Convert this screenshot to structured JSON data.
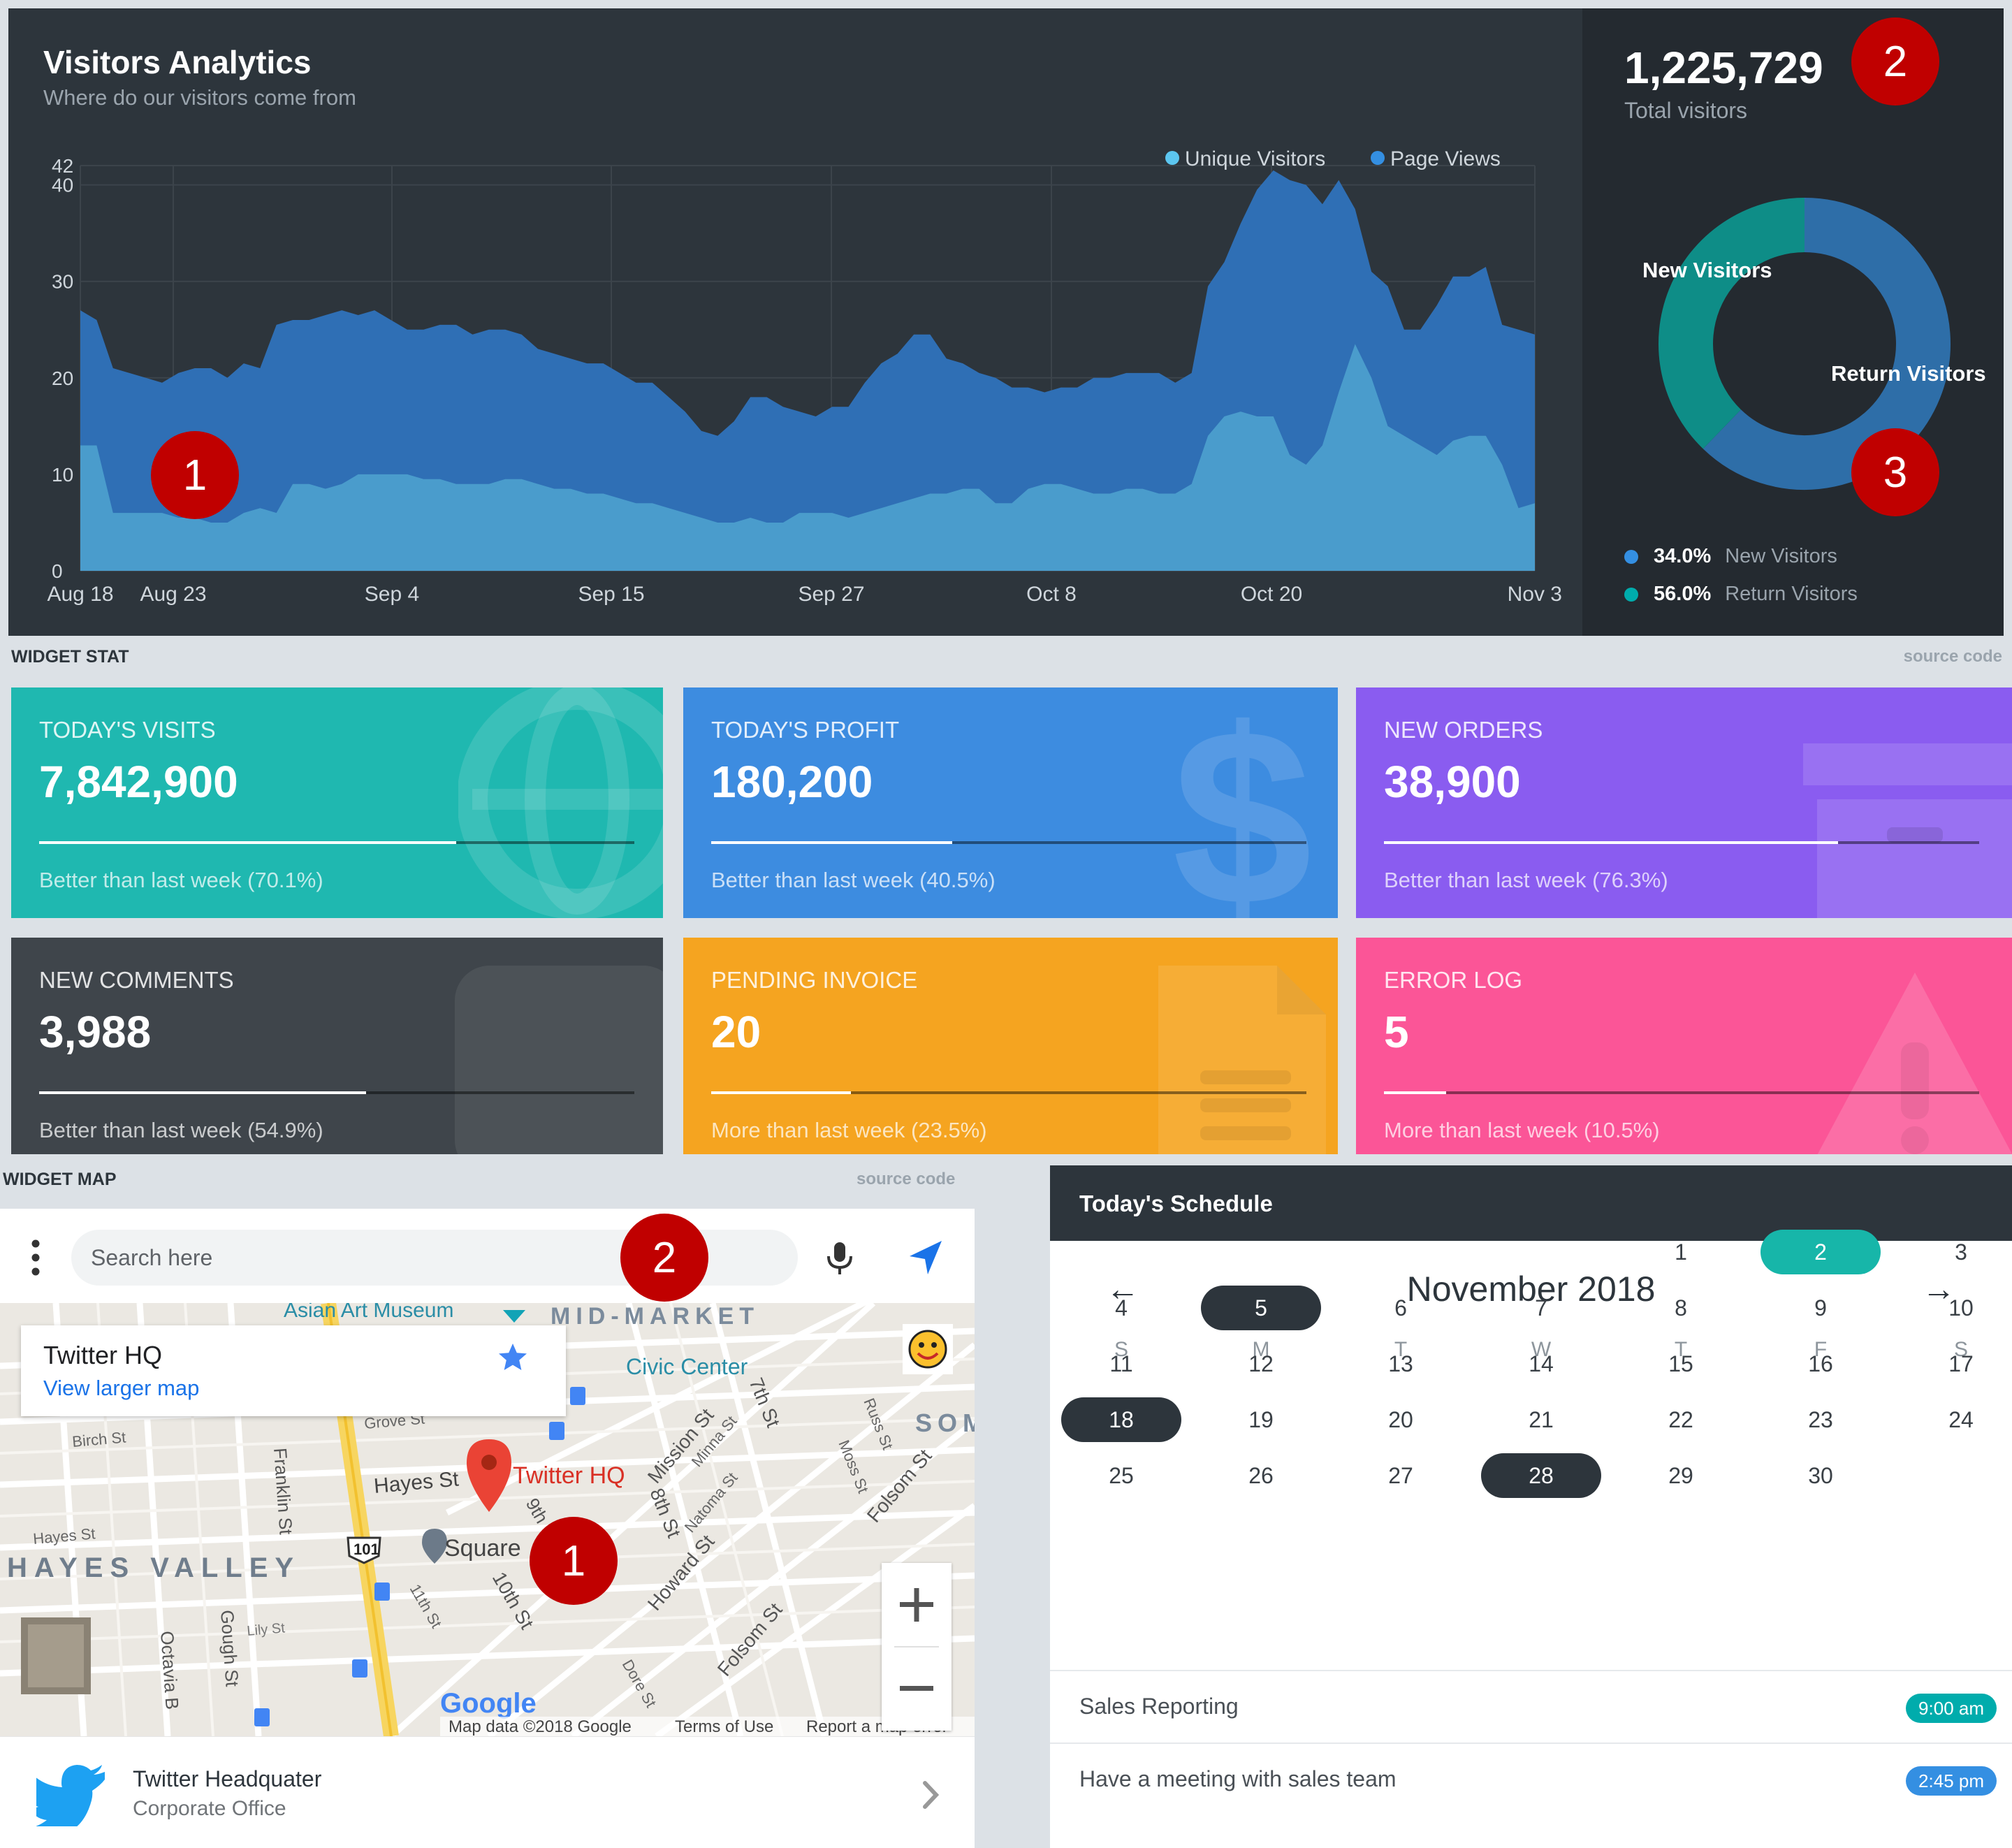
{
  "analytics": {
    "title": "Visitors Analytics",
    "subtitle": "Where do our visitors come from",
    "legend": [
      "Unique Visitors",
      "Page Views"
    ],
    "total_value": "1,225,729",
    "total_label": "Total visitors",
    "donut_labels": {
      "new": "New Visitors",
      "return": "Return Visitors"
    },
    "percentages": [
      {
        "value": "34.0%",
        "label": "New Visitors",
        "color": "#348fe2"
      },
      {
        "value": "56.0%",
        "label": "Return Visitors",
        "color": "#00acac"
      }
    ]
  },
  "badges": {
    "chart": "1",
    "total": "2",
    "donut": "3",
    "map_search": "2",
    "map_pin": "1"
  },
  "chart_data": [
    {
      "type": "area",
      "title": "Visitors Analytics",
      "x_ticks": [
        "Aug 18",
        "Aug 23",
        "Sep 4",
        "Sep 15",
        "Sep 27",
        "Oct 8",
        "Oct 20",
        "Nov 3"
      ],
      "y_ticks": [
        0,
        10,
        20,
        30,
        40,
        42
      ],
      "ylim": [
        0,
        42
      ],
      "colors": {
        "page_views": "#2f6fb5",
        "unique_visitors": "#4a9ccc"
      },
      "series": [
        {
          "name": "Page Views",
          "values": [
            27,
            26,
            21,
            20.5,
            20,
            19.5,
            20.5,
            21,
            21,
            20,
            21.5,
            21,
            25.5,
            26,
            26,
            26.5,
            27,
            26.5,
            27,
            26,
            25,
            25,
            25.5,
            25.5,
            24.5,
            25,
            25,
            24.5,
            23,
            22.5,
            22,
            21.5,
            21.5,
            20.5,
            19.5,
            19.5,
            18,
            16.5,
            14.5,
            14,
            15.5,
            18,
            18,
            17,
            16.5,
            16,
            17,
            17,
            19.5,
            21.5,
            22.5,
            24.5,
            24.5,
            22,
            21.5,
            20.5,
            20,
            19,
            19,
            18.5,
            19,
            19,
            20,
            20,
            20.5,
            20.5,
            20.5,
            19.5,
            20.5,
            29.5,
            32,
            36,
            39.5,
            41.5,
            40.5,
            40,
            38,
            40.5,
            37.5,
            31,
            29.5,
            25,
            25,
            27.5,
            30.5,
            30.5,
            31.5,
            25.5,
            25,
            24.5
          ]
        },
        {
          "name": "Unique Visitors",
          "values": [
            13,
            13,
            6,
            6,
            6,
            6,
            5.5,
            5.5,
            5,
            5,
            6,
            6.5,
            6,
            9,
            9,
            8.5,
            9,
            10,
            10,
            10,
            10,
            9.5,
            9.5,
            9,
            9,
            9,
            9.5,
            9.5,
            9,
            8.5,
            8.5,
            8,
            8,
            7.5,
            7,
            7,
            6.5,
            6,
            5.5,
            5,
            5,
            5.5,
            5,
            5,
            6,
            6,
            6,
            5.5,
            6,
            6.5,
            7,
            7.5,
            8,
            8,
            8.5,
            8.5,
            7,
            7,
            8.5,
            9,
            9,
            8.5,
            8,
            8,
            8.5,
            8.5,
            8,
            8,
            9,
            14,
            16,
            16.5,
            16,
            16,
            12,
            11,
            13,
            18.5,
            23.5,
            20,
            15,
            14,
            13,
            12,
            13.5,
            14,
            14,
            11,
            6.5,
            7
          ]
        }
      ]
    },
    {
      "type": "pie",
      "categories": [
        "New Visitors",
        "Return Visitors"
      ],
      "values": [
        34.0,
        56.0
      ],
      "colors": [
        "#00acac",
        "#348fe2"
      ]
    }
  ],
  "widget_stat": {
    "section_label": "WIDGET STAT",
    "source_link": "source code",
    "cards": [
      {
        "title": "TODAY'S VISITS",
        "value": "7,842,900",
        "desc": "Better than last week (70.1%)",
        "progress": 0.701,
        "icon": "globe-icon",
        "bg": "#1fb8b0"
      },
      {
        "title": "TODAY'S PROFIT",
        "value": "180,200",
        "desc": "Better than last week (40.5%)",
        "progress": 0.405,
        "icon": "dollar-icon",
        "bg": "#3d8ce0"
      },
      {
        "title": "NEW ORDERS",
        "value": "38,900",
        "desc": "Better than last week (76.3%)",
        "progress": 0.763,
        "icon": "archive-icon",
        "bg": "#8a5cf0"
      },
      {
        "title": "NEW COMMENTS",
        "value": "3,988",
        "desc": "Better than last week (54.9%)",
        "progress": 0.549,
        "icon": "comment-icon",
        "bg": "#3f454b"
      },
      {
        "title": "PENDING INVOICE",
        "value": "20",
        "desc": "More than last week (23.5%)",
        "progress": 0.235,
        "icon": "file-icon",
        "bg": "#f5a420"
      },
      {
        "title": "ERROR LOG",
        "value": "5",
        "desc": "More than last week (10.5%)",
        "progress": 0.105,
        "icon": "warning-icon",
        "bg": "#fb5597"
      }
    ]
  },
  "widget_map": {
    "section_label": "WIDGET MAP",
    "source_link": "source code",
    "search_placeholder": "Search here",
    "info_title": "Twitter HQ",
    "info_link": "View larger map",
    "pin_label": "Twitter HQ",
    "map_labels": {
      "museum": "Asian Art Museum",
      "mid_market": "MID-MARKET",
      "civic_center": "Civic Center",
      "soma": "SOM",
      "hayes_valley": "HAYES VALLEY",
      "hayes_st": "Hayes St",
      "hayes_st_small": "Hayes St",
      "grove_st": "Grove St",
      "birch_st": "Birch St",
      "franklin_st": "Franklin St",
      "gough_st": "Gough St",
      "octavia": "Octavia B",
      "lily_st": "Lily St",
      "mission_st": "Mission St",
      "minna_st": "Minna St",
      "seventh_st": "7th St",
      "eighth_st": "8th St",
      "natoma_st": "Natoma St",
      "russ_st": "Russ St",
      "moss_st": "Moss St",
      "folsom_st": "Folsom St",
      "folsom_st_lower": "Folsom St",
      "howard_st": "Howard St",
      "tenth_st": "10th St",
      "eleventh_st": "11th St",
      "ninth": "9th",
      "dore_st": "Dore St",
      "square": "Square",
      "route": "101",
      "google": "Google",
      "map_data": "Map data ©2018 Google",
      "terms": "Terms of Use",
      "report": "Report a map error"
    },
    "place_title": "Twitter Headquater",
    "place_subtitle": "Corporate Office"
  },
  "schedule": {
    "title": "Today's Schedule",
    "month": "November 2018",
    "weekdays": [
      "S",
      "M",
      "T",
      "W",
      "T",
      "F",
      "S"
    ],
    "weeks": [
      [
        "",
        "",
        "",
        "",
        "1",
        "2",
        "3"
      ],
      [
        "4",
        "5",
        "6",
        "7",
        "8",
        "9",
        "10"
      ],
      [
        "11",
        "12",
        "13",
        "14",
        "15",
        "16",
        "17"
      ],
      [
        "18",
        "19",
        "20",
        "21",
        "22",
        "23",
        "24"
      ],
      [
        "25",
        "26",
        "27",
        "28",
        "29",
        "30",
        ""
      ]
    ],
    "highlight_teal": [
      "2"
    ],
    "highlight_dark": [
      "5",
      "18",
      "28"
    ],
    "events": [
      {
        "name": "Sales Reporting",
        "time": "9:00 am",
        "color": "#00acac"
      },
      {
        "name": "Have a meeting with sales team",
        "time": "2:45 pm",
        "color": "#348fe2"
      }
    ]
  }
}
